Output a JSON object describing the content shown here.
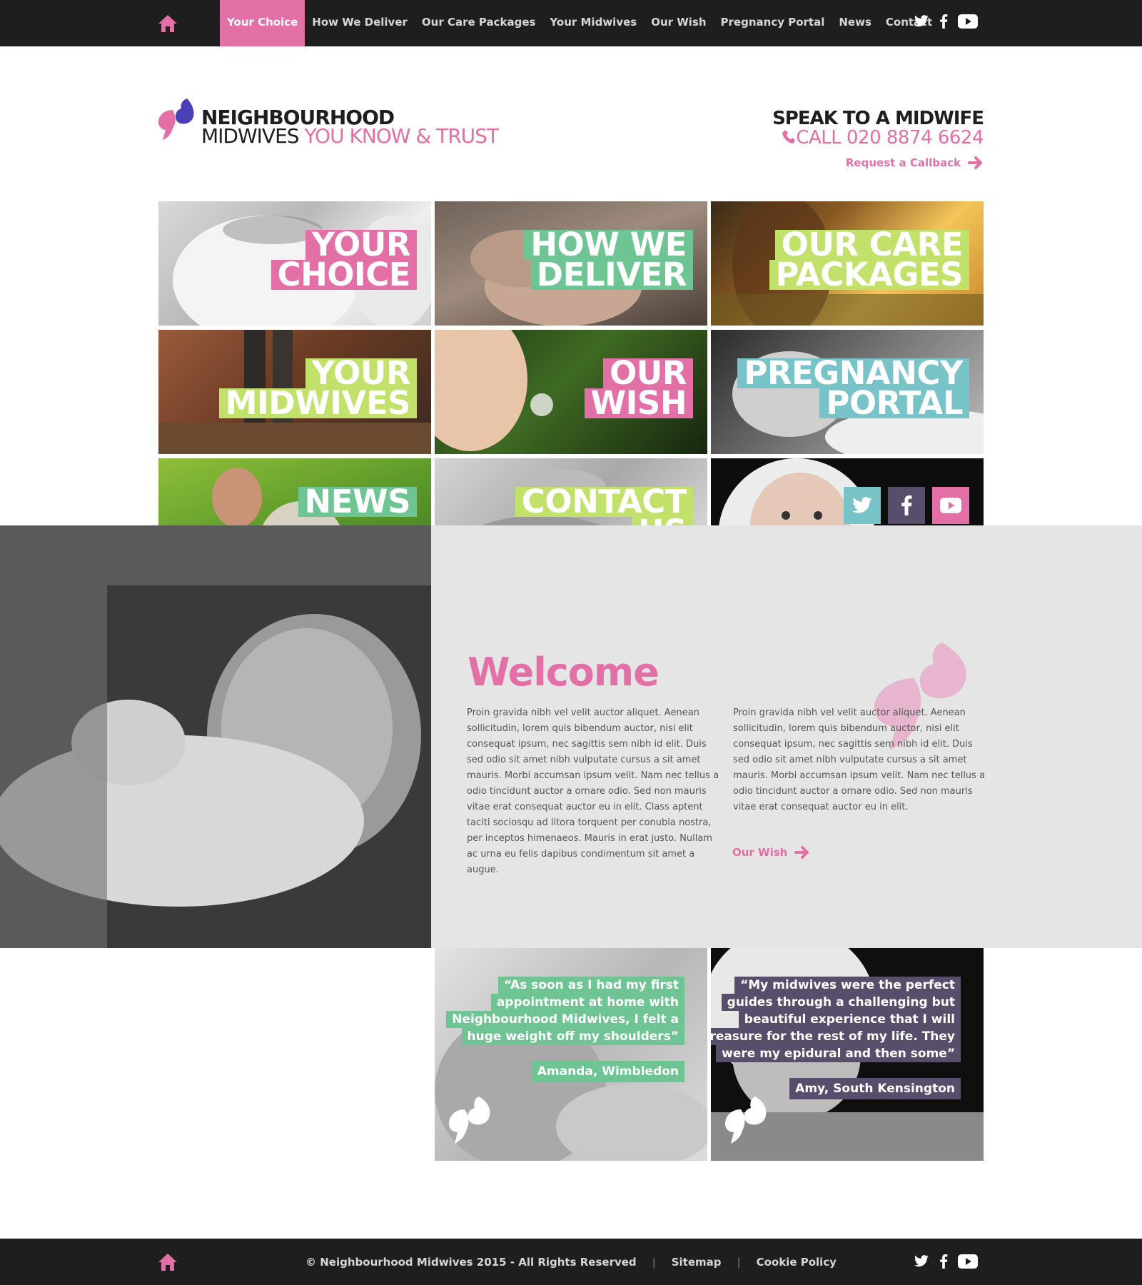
{
  "colors": {
    "pink": "#e26fa5",
    "green": "#6fc494",
    "lime": "#c1e16a",
    "teal": "#78c3c8",
    "purple": "#574e6c",
    "dark": "#1e1e1e",
    "grey": "#e6e5e6"
  },
  "nav": {
    "home_icon": "home-icon",
    "items": [
      {
        "label": "Your Choice",
        "active": true
      },
      {
        "label": "How We Deliver"
      },
      {
        "label": "Our Care Packages"
      },
      {
        "label": "Your Midwives"
      },
      {
        "label": "Our Wish"
      },
      {
        "label": "Pregnancy Portal"
      },
      {
        "label": "News"
      },
      {
        "label": "Contact"
      }
    ],
    "social_icons": [
      "twitter-icon",
      "facebook-icon",
      "youtube-icon"
    ]
  },
  "header": {
    "logo_line1": "NEIGHBOURHOOD",
    "logo_line2_dark": "MIDWIVES",
    "logo_line2_pink": "YOU KNOW & TRUST",
    "speak_title": "SPEAK TO A MIDWIFE",
    "call_text": "CALL 020 8874 6624",
    "callback": "Request a Callback"
  },
  "tiles": [
    {
      "lines": [
        "YOUR",
        "CHOICE"
      ],
      "color": "pink"
    },
    {
      "lines": [
        "HOW WE",
        "DELIVER"
      ],
      "color": "green"
    },
    {
      "lines": [
        "OUR CARE",
        "PACKAGES"
      ],
      "color": "lime"
    },
    {
      "lines": [
        "YOUR",
        "MIDWIVES"
      ],
      "color": "lime"
    },
    {
      "lines": [
        "OUR",
        "WISH"
      ],
      "color": "pink"
    },
    {
      "lines": [
        "PREGNANCY",
        "PORTAL"
      ],
      "color": "teal"
    },
    {
      "lines": [
        "NEWS"
      ],
      "color": "green"
    },
    {
      "lines": [
        "CONTACT",
        "US"
      ],
      "color": "lime"
    }
  ],
  "welcome": {
    "title": "Welcome",
    "col1": "Proin gravida nibh vel velit auctor aliquet. Aenean sollicitudin, lorem quis bibendum auctor, nisi elit consequat ipsum, nec sagittis sem nibh id elit. Duis sed odio sit amet nibh vulputate cursus a sit amet mauris. Morbi accumsan ipsum velit. Nam nec tellus a odio tincidunt auctor a ornare odio. Sed non  mauris vitae erat consequat auctor eu in elit. Class aptent taciti sociosqu ad litora torquent per conubia nostra, per inceptos himenaeos. Mauris in erat justo. Nullam ac urna eu felis dapibus condimentum sit amet a augue.",
    "col2": "Proin gravida nibh vel velit auctor aliquet. Aenean sollicitudin, lorem quis bibendum auctor, nisi elit consequat ipsum, nec sagittis sem nibh id elit. Duis sed odio sit amet nibh vulputate cursus a sit amet mauris. Morbi accumsan ipsum velit. Nam nec tellus a odio tincidunt auctor a ornare odio. Sed non  mauris vitae erat consequat auctor eu in elit.",
    "link": "Our Wish"
  },
  "testimonials": [
    {
      "lines": [
        "“As soon as I had my first",
        "appointment at home with",
        "Neighbourhood Midwives, I felt a",
        "huge weight off my shoulders”"
      ],
      "author": "Amanda, Wimbledon",
      "color": "green"
    },
    {
      "lines": [
        "“My midwives were the perfect",
        "guides through a challenging but",
        "beautiful experience that I will",
        "treasure for the rest of my life. They",
        "were my epidural and then some”"
      ],
      "author": "Amy, South Kensington",
      "color": "purple"
    }
  ],
  "footer": {
    "copyright": "© Neighbourhood Midwives 2015 - All Rights Reserved",
    "sep": "|",
    "sitemap": "Sitemap",
    "cookie": "Cookie Policy"
  }
}
